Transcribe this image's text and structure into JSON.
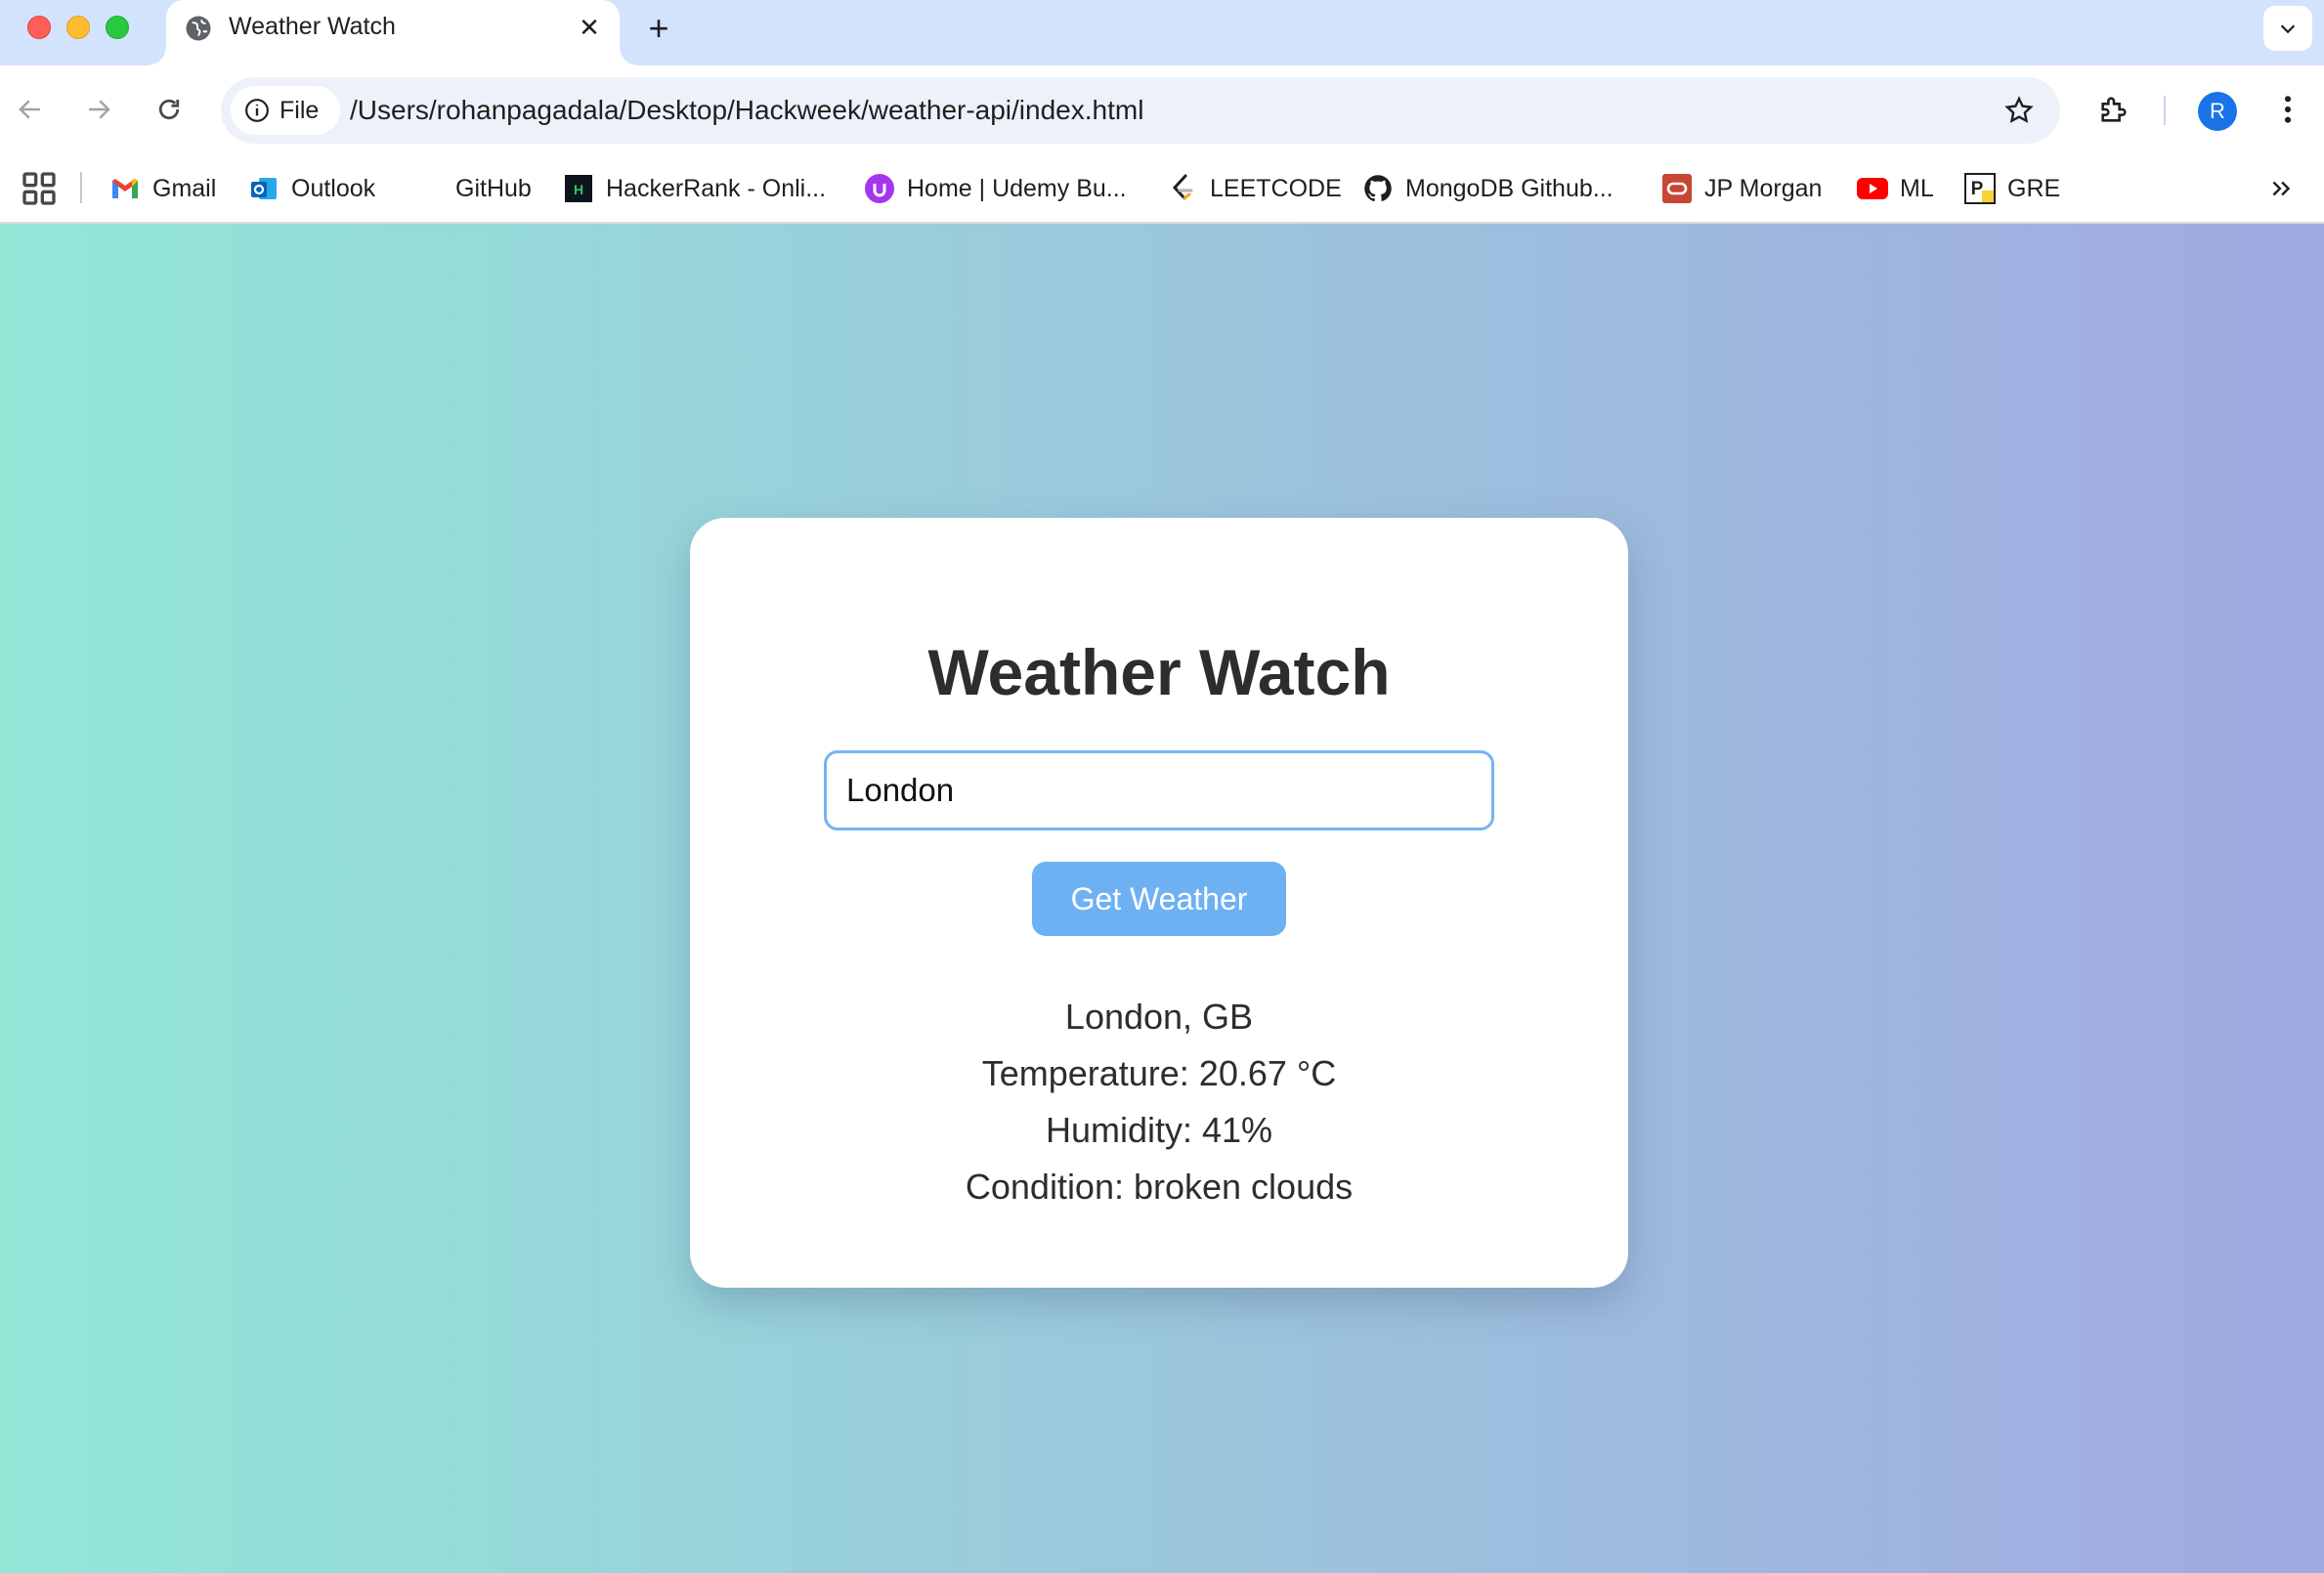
{
  "browser": {
    "tab": {
      "title": "Weather Watch"
    },
    "url": "/Users/rohanpagadala/Desktop/Hackweek/weather-api/index.html",
    "url_chip": "File",
    "profile_initial": "R"
  },
  "bookmarks": [
    {
      "label": "Gmail",
      "icon": "gmail-icon"
    },
    {
      "label": "Outlook",
      "icon": "outlook-icon"
    },
    {
      "label": "GitHub",
      "icon": "none"
    },
    {
      "label": "HackerRank - Onli...",
      "icon": "hackerrank-icon"
    },
    {
      "label": "Home | Udemy Bu...",
      "icon": "udemy-icon"
    },
    {
      "label": "LEETCODE",
      "icon": "leetcode-icon"
    },
    {
      "label": "MongoDB Github...",
      "icon": "github-icon"
    },
    {
      "label": "JP Morgan",
      "icon": "oracle-icon"
    },
    {
      "label": "ML",
      "icon": "youtube-icon"
    },
    {
      "label": "GRE",
      "icon": "prep-icon"
    }
  ],
  "app": {
    "title": "Weather Watch",
    "input_value": "London",
    "button_label": "Get Weather",
    "result": {
      "location": "London, GB",
      "temperature": "Temperature: 20.67 °C",
      "humidity": "Humidity: 41%",
      "condition": "Condition: broken clouds"
    }
  },
  "colors": {
    "gradient_start": "#92e7d7",
    "gradient_end": "#a1a9e1",
    "button": "#6eb1f3",
    "input_border": "#74b3f4"
  }
}
